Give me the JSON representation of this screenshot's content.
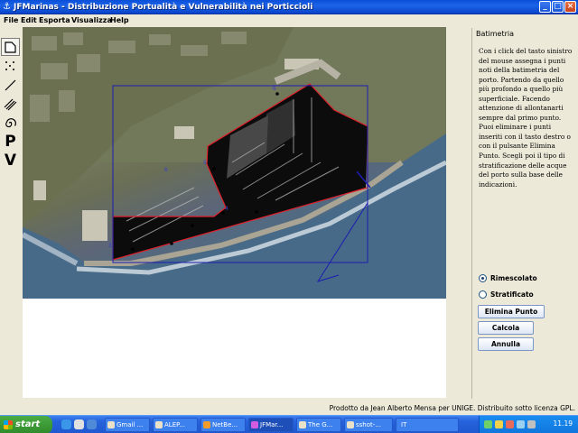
{
  "window": {
    "title": "JFMarinas - Distribuzione Portualità e Vulnerabilità nei Porticcioli",
    "controls": [
      "minimize",
      "maximize",
      "close"
    ]
  },
  "menu": [
    "File",
    "Edit",
    "Esporta",
    "Visualizza",
    "Help"
  ],
  "toolbar": {
    "tools": [
      {
        "name": "polygon-tool-icon",
        "glyph": ""
      },
      {
        "name": "points-tool-icon",
        "glyph": ""
      },
      {
        "name": "line-tool-icon",
        "glyph": ""
      },
      {
        "name": "hatch-tool-icon",
        "glyph": ""
      },
      {
        "name": "spiral-tool-icon",
        "glyph": ""
      },
      {
        "name": "p-tool",
        "glyph": "P"
      },
      {
        "name": "v-tool",
        "glyph": "V"
      }
    ]
  },
  "panel": {
    "title": "Batimetria",
    "instructions": "Con i click del tasto sinistro del mouse assegna i punti noti della batimetria del porto. Partendo da quello più profondo a quello più superficiale. Facendo attenzione di allontanarti sempre dal primo punto. Puoi eliminare i punti inseriti con il tasto destro o con il pulsante Elimina Punto. Scegli poi il tipo di stratificazione delle acque del porto sulla base delle indicazioni.",
    "radios": [
      {
        "label": "Rimescolato",
        "selected": true
      },
      {
        "label": "Stratificato",
        "selected": false
      }
    ],
    "buttons": {
      "delete": "Elimina Punto",
      "compute": "Calcola",
      "cancel": "Annulla"
    }
  },
  "status": "Prodotto da Jean Alberto Mensa per UNIGE. Distribuito sotto licenza GPL.",
  "taskbar": {
    "start": "start",
    "tasks": [
      {
        "label": "Gmail ...",
        "active": false
      },
      {
        "label": "ALEP...",
        "active": false
      },
      {
        "label": "NetBe...",
        "active": false
      },
      {
        "label": "JFMar...",
        "active": true
      },
      {
        "label": "The G...",
        "active": false
      },
      {
        "label": "sshot-...",
        "active": false
      },
      {
        "label": "IT",
        "active": false
      }
    ],
    "clock": "11.19"
  },
  "colors": {
    "titlebar": "#0a4fd8",
    "harbor_outline": "#e0202a",
    "bbox": "#1c1cb0",
    "accent_green": "#2f8a2a"
  }
}
